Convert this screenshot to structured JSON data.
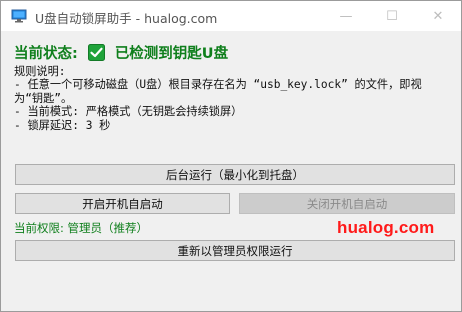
{
  "window": {
    "title": "U盘自动锁屏助手 - hualog.com",
    "minimize_glyph": "—",
    "maximize_glyph": "☐",
    "close_glyph": "✕"
  },
  "status": {
    "label": "当前状态:",
    "value": "已检测到钥匙U盘",
    "icon": "checkbox-checked-icon",
    "color": "#0f7f1c"
  },
  "rules": {
    "lines": [
      "规则说明:",
      "- 任意一个可移动磁盘（U盘）根目录存在名为 “usb_key.lock” 的文件，即视",
      "为“钥匙”。",
      "- 当前模式: 严格模式（无钥匙会持续锁屏）",
      "- 锁屏延迟: 3 秒"
    ]
  },
  "buttons": {
    "background_run": "后台运行（最小化到托盘）",
    "enable_autostart": "开启开机自启动",
    "disable_autostart": "关闭开机自启动",
    "restart_admin": "重新以管理员权限运行"
  },
  "permission": {
    "text": "当前权限: 管理员（推荐）"
  },
  "watermark": {
    "text": "hualog.com",
    "color": "#ff1a1a"
  }
}
